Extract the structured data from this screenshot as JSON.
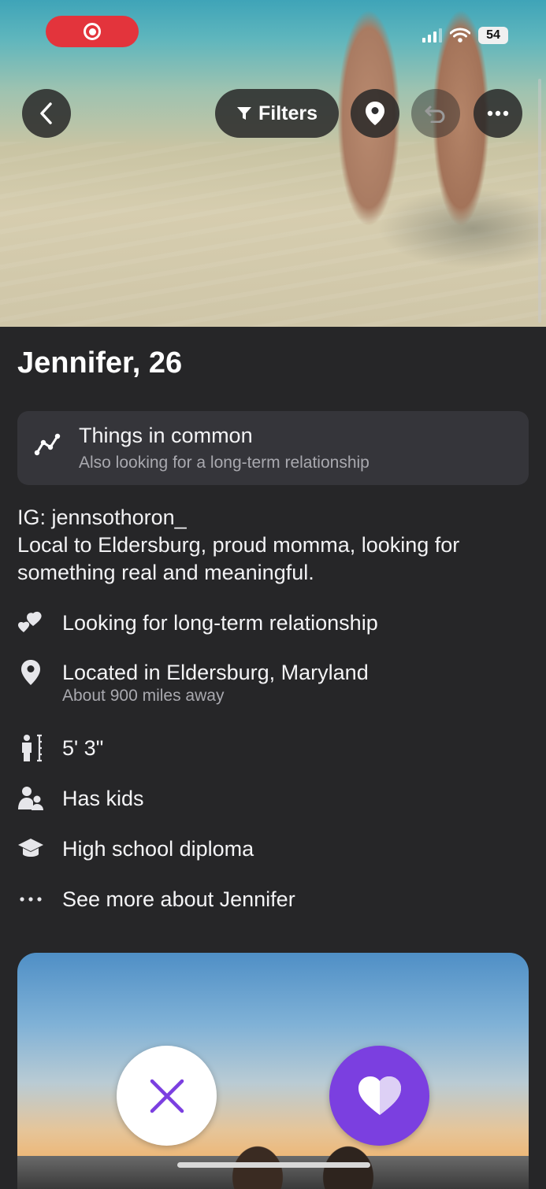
{
  "status_bar": {
    "battery": "54",
    "icons": [
      "screen-record-icon",
      "signal-icon",
      "wifi-icon",
      "battery-icon"
    ],
    "record_color": "#e3343c"
  },
  "toolbar": {
    "filters_label": "Filters",
    "icons": [
      "chevron-left-icon",
      "filter-icon",
      "location-pin-icon",
      "undo-icon",
      "more-horizontal-icon"
    ]
  },
  "profile": {
    "name_age": "Jennifer, 26",
    "common": {
      "title": "Things in common",
      "subtitle": "Also looking for a long-term relationship"
    },
    "bio": [
      "IG: jennsothoron_",
      "Local to Eldersburg, proud momma, looking for",
      "something real and meaningful."
    ],
    "details": [
      {
        "icon": "hearts-icon",
        "text": "Looking for long-term relationship"
      },
      {
        "icon": "location-pin-icon",
        "text": "Located in Eldersburg, Maryland",
        "sub": "About 900 miles away"
      },
      {
        "icon": "height-icon",
        "text": "5' 3\""
      },
      {
        "icon": "kids-icon",
        "text": "Has kids"
      },
      {
        "icon": "graduation-cap-icon",
        "text": "High school diploma"
      },
      {
        "icon": "ellipsis-icon",
        "text": "See more about Jennifer"
      }
    ]
  },
  "actions": {
    "pass_icon": "close-x-icon",
    "like_icon": "heart-icon",
    "accent": "#7b3fe0"
  }
}
